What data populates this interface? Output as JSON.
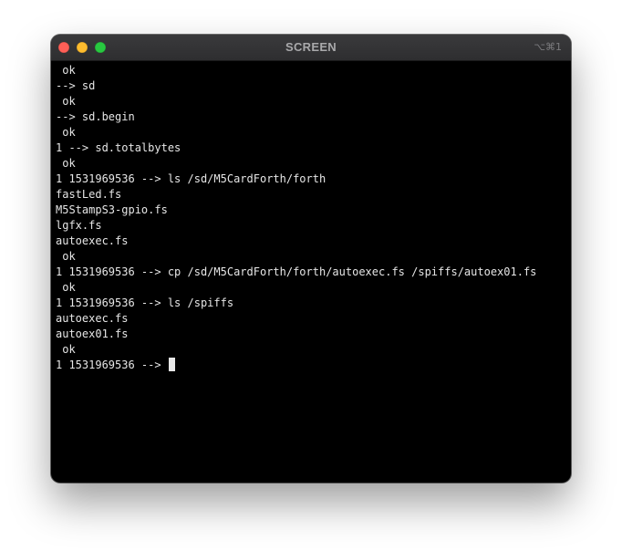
{
  "window": {
    "title": "SCREEN",
    "shortcut": "⌥⌘1"
  },
  "terminal": {
    "lines": [
      " ok",
      "--> sd",
      " ok",
      "--> sd.begin",
      " ok",
      "1 --> sd.totalbytes",
      " ok",
      "1 1531969536 --> ls /sd/M5CardForth/forth",
      "fastLed.fs",
      "M5StampS3-gpio.fs",
      "lgfx.fs",
      "autoexec.fs",
      " ok",
      "1 1531969536 --> cp /sd/M5CardForth/forth/autoexec.fs /spiffs/autoex01.fs",
      " ok",
      "1 1531969536 --> ls /spiffs",
      "autoexec.fs",
      "autoex01.fs",
      " ok"
    ],
    "prompt": "1 1531969536 --> "
  },
  "colors": {
    "background": "#000000",
    "text": "#e6e6e6",
    "titlebar": "#333335",
    "close": "#ff5f57",
    "minimize": "#febc2e",
    "zoom": "#28c840"
  }
}
